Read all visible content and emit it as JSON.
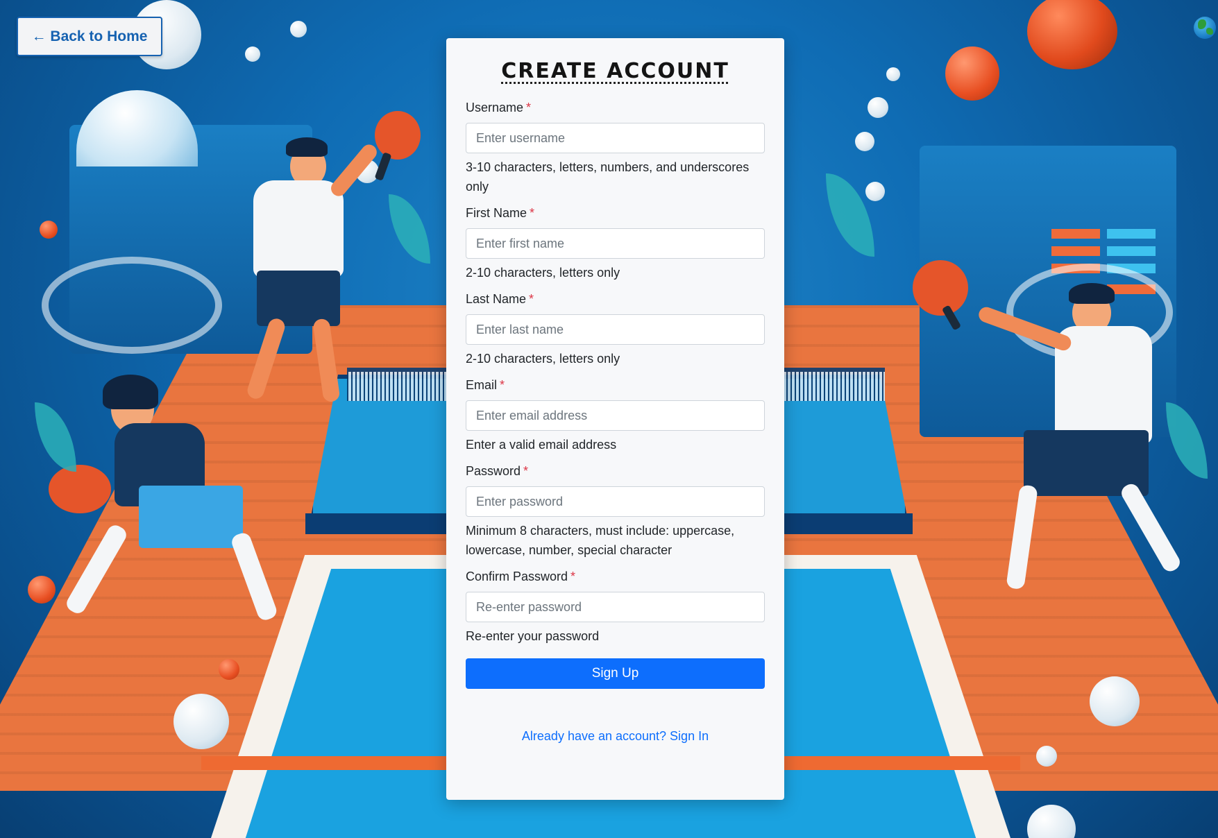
{
  "nav": {
    "back_label": "← Back to Home",
    "globe_icon": "globe-icon"
  },
  "form": {
    "title": "CREATE ACCOUNT",
    "required_marker": "*",
    "fields": [
      {
        "label": "Username",
        "placeholder": "Enter username",
        "help": "3-10 characters, letters, numbers, and underscores only"
      },
      {
        "label": "First Name",
        "placeholder": "Enter first name",
        "help": "2-10 characters, letters only"
      },
      {
        "label": "Last Name",
        "placeholder": "Enter last name",
        "help": "2-10 characters, letters only"
      },
      {
        "label": "Email",
        "placeholder": "Enter email address",
        "help": "Enter a valid email address"
      },
      {
        "label": "Password",
        "placeholder": "Enter password",
        "help": "Minimum 8 characters, must include: uppercase, lowercase, number, special character"
      },
      {
        "label": "Confirm Password",
        "placeholder": "Re-enter password",
        "help": "Re-enter your password"
      }
    ],
    "submit_label": "Sign Up",
    "signin_link": "Already have an account? Sign In"
  },
  "colors": {
    "primary": "#0d6efd",
    "required": "#dc3545",
    "back_button_text": "#1662b1",
    "card_bg": "#f7f8fa"
  }
}
